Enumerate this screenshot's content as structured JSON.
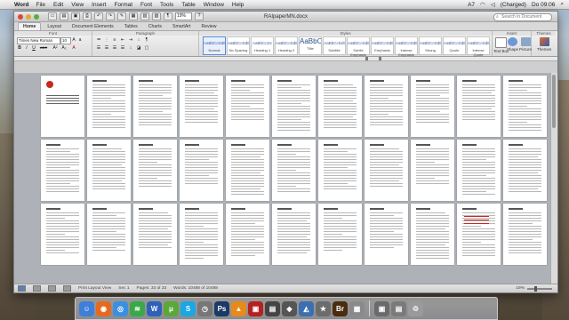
{
  "menubar": {
    "apple": "",
    "app": "Word",
    "items": [
      "File",
      "Edit",
      "View",
      "Insert",
      "Format",
      "Font",
      "Tools",
      "Table",
      "Window",
      "Help"
    ],
    "status": {
      "keyboard": "A7",
      "battery": "(Charged)",
      "clock": "Do 09:06"
    }
  },
  "window": {
    "title": "RAIpaperMN.docx",
    "zoom_value": "19%",
    "search_placeholder": "Search in Document"
  },
  "ribbon": {
    "tabs": [
      "Home",
      "Layout",
      "Document Elements",
      "Tables",
      "Charts",
      "SmartArt",
      "Review"
    ],
    "active_tab": "Home",
    "groups": {
      "font": "Font",
      "paragraph": "Paragraph",
      "styles": "Styles",
      "insert": "Insert",
      "themes": "Themes"
    },
    "font_name": "Times New Roman",
    "font_size": "10",
    "format_buttons": [
      "B",
      "I",
      "U",
      "ABC",
      "A²",
      "A₂",
      "A"
    ],
    "styles": [
      {
        "sample": "AaBbCcDdEe",
        "name": "Normal"
      },
      {
        "sample": "AaBbCcDdEe",
        "name": "No Spacing"
      },
      {
        "sample": "AaBbCcDc",
        "name": "Heading 1"
      },
      {
        "sample": "AaBbCcDdEe",
        "name": "Heading 2"
      },
      {
        "sample": "AaBbC",
        "name": "Title"
      },
      {
        "sample": "AaBbCcDdt",
        "name": "Subtitle"
      },
      {
        "sample": "AaBbCcDdEe",
        "name": "Subtle Emphasis"
      },
      {
        "sample": "AaBbCcDdEe",
        "name": "Emphasis"
      },
      {
        "sample": "AaBbCcDdEe",
        "name": "Intense Emphasis"
      },
      {
        "sample": "AaBbCcDdE",
        "name": "Strong"
      },
      {
        "sample": "AaBbCcDdEe",
        "name": "Quote"
      },
      {
        "sample": "AaBbCcDdEe",
        "name": "Intense Quote"
      }
    ],
    "insert_buttons": [
      "Text Box",
      "Shape",
      "Picture"
    ],
    "themes_button": "Themes"
  },
  "statusbar": {
    "view_label": "Print Layout View",
    "sec": "Sec",
    "sec_value": "1",
    "pages": "Pages:",
    "pages_value": "33 of 33",
    "words": "Words:",
    "words_value": "10488 of 10488",
    "zoom": "19%"
  },
  "dock": {
    "icons": [
      {
        "name": "finder-icon",
        "glyph": "☺",
        "color": "#3d7fd9"
      },
      {
        "name": "firefox-icon",
        "glyph": "◉",
        "color": "#e66a1e"
      },
      {
        "name": "safari-icon",
        "glyph": "◎",
        "color": "#3b8fe0"
      },
      {
        "name": "spotify-icon",
        "glyph": "≋",
        "color": "#3aa84a"
      },
      {
        "name": "word-icon",
        "glyph": "W",
        "color": "#2e62b8"
      },
      {
        "name": "utorrent-icon",
        "glyph": "μ",
        "color": "#5aa83a"
      },
      {
        "name": "skype-icon",
        "glyph": "S",
        "color": "#1aa7e3"
      },
      {
        "name": "clock-icon",
        "glyph": "◷",
        "color": "#777777"
      },
      {
        "name": "photoshop-icon",
        "glyph": "Ps",
        "color": "#1d3a66"
      },
      {
        "name": "vlc-icon",
        "glyph": "▲",
        "color": "#e88a1a"
      },
      {
        "name": "flashcards-icon",
        "glyph": "▣",
        "color": "#b52020"
      },
      {
        "name": "dictionary-icon",
        "glyph": "▤",
        "color": "#444444"
      },
      {
        "name": "silverlight-icon",
        "glyph": "◆",
        "color": "#555555"
      },
      {
        "name": "iphoto-icon",
        "glyph": "◭",
        "color": "#3c6fb0"
      },
      {
        "name": "imovie-icon",
        "glyph": "★",
        "color": "#6c6c6c"
      },
      {
        "name": "bridge-icon",
        "glyph": "Br",
        "color": "#4a2d10"
      },
      {
        "name": "preview-icon",
        "glyph": "▦",
        "color": "#8a8a8a"
      },
      {
        "name": "downloads-stack-icon",
        "glyph": "▣",
        "color": "#6a6a6a"
      },
      {
        "name": "documents-stack-icon",
        "glyph": "▤",
        "color": "#7a7a7a"
      },
      {
        "name": "trash-icon",
        "glyph": "♲",
        "color": "#9a9a9a"
      }
    ]
  }
}
